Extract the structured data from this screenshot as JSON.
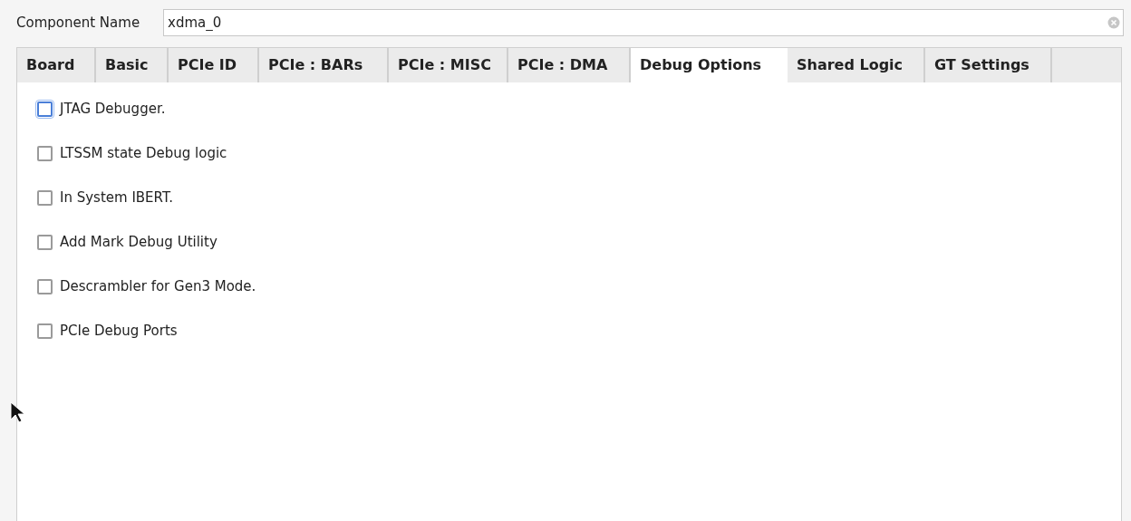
{
  "component_name": {
    "label": "Component Name",
    "value": "xdma_0"
  },
  "tabs": [
    {
      "label": "Board",
      "selected": false
    },
    {
      "label": "Basic",
      "selected": false
    },
    {
      "label": "PCIe ID",
      "selected": false
    },
    {
      "label": "PCIe : BARs",
      "selected": false
    },
    {
      "label": "PCIe : MISC",
      "selected": false
    },
    {
      "label": "PCIe : DMA",
      "selected": false
    },
    {
      "label": "Debug Options",
      "selected": true
    },
    {
      "label": "Shared Logic",
      "selected": false
    },
    {
      "label": "GT Settings",
      "selected": false
    }
  ],
  "options": [
    {
      "label": "JTAG Debugger.",
      "checked": false,
      "focused": true
    },
    {
      "label": "LTSSM state Debug logic",
      "checked": false,
      "focused": false
    },
    {
      "label": "In System IBERT.",
      "checked": false,
      "focused": false
    },
    {
      "label": "Add Mark Debug Utility",
      "checked": false,
      "focused": false
    },
    {
      "label": "Descrambler for Gen3 Mode.",
      "checked": false,
      "focused": false
    },
    {
      "label": "PCIe Debug Ports",
      "checked": false,
      "focused": false
    }
  ]
}
